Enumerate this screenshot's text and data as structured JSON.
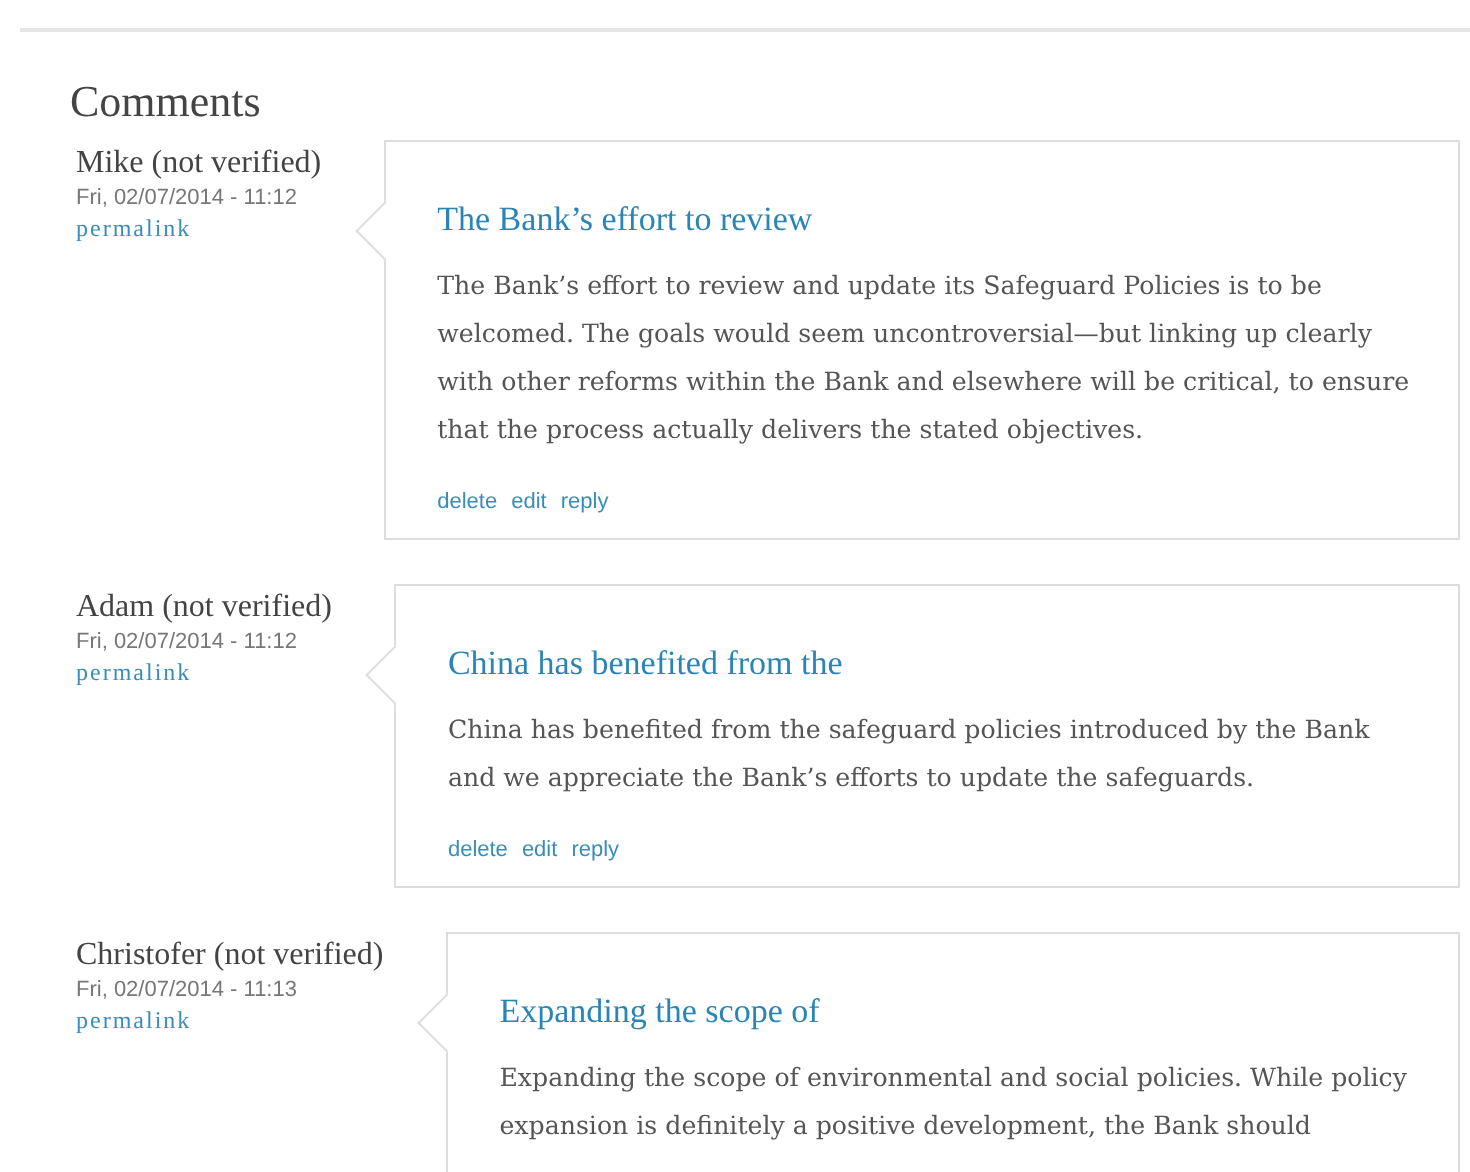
{
  "heading": "Comments",
  "comments": [
    {
      "author": "Mike (not verified)",
      "date": "Fri, 02/07/2014 - 11:12",
      "permalink": "permalink",
      "title": "The Bank’s effort to review",
      "body": "The Bank’s effort to review and update its Safeguard Policies is to be welcomed. The goals would seem uncontroversial—but linking up clearly with other reforms within the Bank and elsewhere will be critical, to ensure that the process actually delivers the stated objectives.",
      "links": [
        "delete",
        "edit",
        "reply"
      ]
    },
    {
      "author": "Adam (not verified)",
      "date": "Fri, 02/07/2014 - 11:12",
      "permalink": "permalink",
      "title": "China has benefited from the",
      "body": "China has benefited from the safeguard policies introduced by the Bank and we appreciate the Bank’s efforts to update the safeguards.",
      "links": [
        "delete",
        "edit",
        "reply"
      ]
    },
    {
      "author": "Christofer (not verified)",
      "date": "Fri, 02/07/2014 - 11:13",
      "permalink": "permalink",
      "title": "Expanding the scope of",
      "body": "Expanding the scope of environmental and social policies. While policy expansion is definitely a positive development, the Bank should"
    }
  ]
}
